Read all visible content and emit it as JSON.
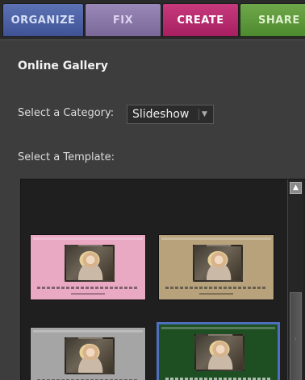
{
  "tabs": [
    {
      "label": "ORGANIZE",
      "color": "#3e5294"
    },
    {
      "label": "FIX",
      "color": "#7a6899"
    },
    {
      "label": "CREATE",
      "color": "#a61f60",
      "active": true
    },
    {
      "label": "SHARE",
      "color": "#4d8a2e"
    }
  ],
  "panel": {
    "title": "Online Gallery",
    "category_label": "Select a Category:",
    "category_value": "Slideshow",
    "template_label": "Select a Template:"
  },
  "templates": [
    {
      "color": "#eaa9c3",
      "selected": false
    },
    {
      "color": "#b7a27c",
      "selected": false
    },
    {
      "color": "#a5a5a5",
      "selected": false
    },
    {
      "color": "#1e4f23",
      "selected": true
    }
  ],
  "icons": {
    "dropdown": "chevron-down-icon",
    "scroll_up": "arrow-up-icon"
  }
}
